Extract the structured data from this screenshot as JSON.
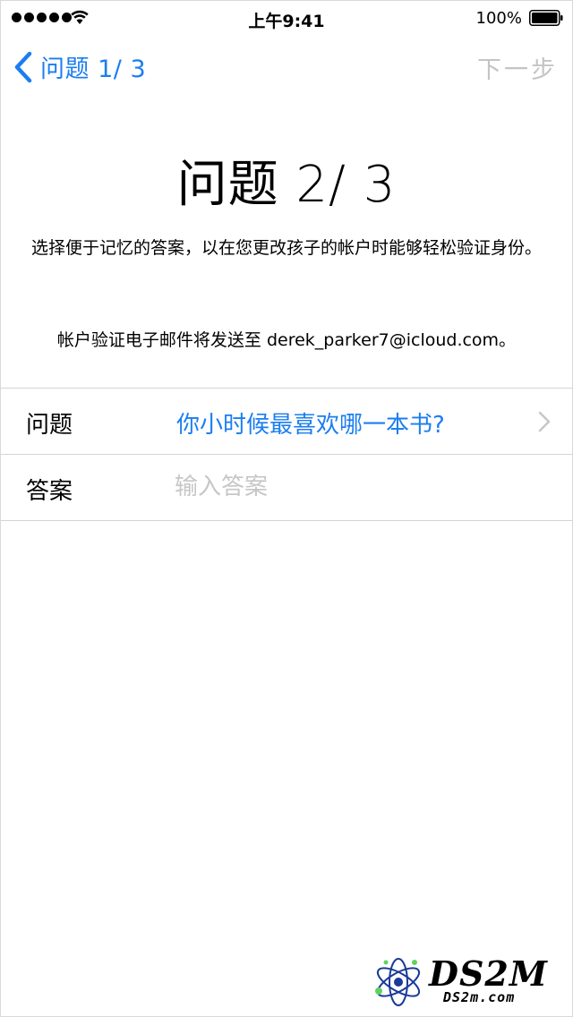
{
  "colors": {
    "accent": "#1b7ef0",
    "disabled": "#c4c4c4",
    "separator": "#d4d4d4",
    "placeholder": "#c6c6c6"
  },
  "status_bar": {
    "time": "上午9:41",
    "battery_percent": "100%",
    "signal_icon": "cellular-signal-icon",
    "wifi_icon": "wifi-icon",
    "battery_icon": "battery-full-icon"
  },
  "nav": {
    "back_label": "问题 1/ 3",
    "back_icon": "chevron-left-icon",
    "next_label": "下一步"
  },
  "header": {
    "title": "问题 2/ 3",
    "instructions": "选择便于记忆的答案，以在您更改孩子的帐户时能够轻松验证身份。",
    "email_note": "帐户验证电子邮件将发送至 derek_parker7@icloud.com。"
  },
  "form": {
    "question_label": "问题",
    "question_value": "你小时候最喜欢哪一本书?",
    "question_icon": "chevron-right-icon",
    "answer_label": "答案",
    "answer_value": "",
    "answer_placeholder": "输入答案"
  },
  "watermark": {
    "brand": "DS2M",
    "site": "DS2m.com"
  }
}
